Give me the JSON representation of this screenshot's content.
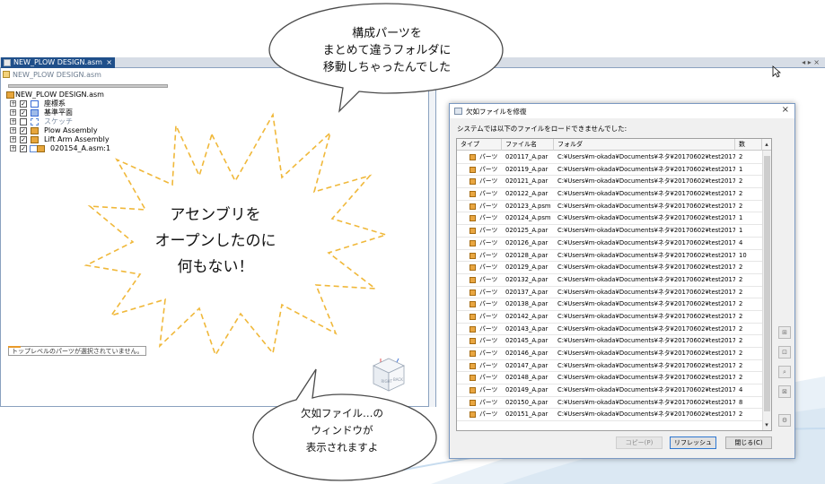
{
  "cad": {
    "tab_label": "NEW_PLOW DESIGN.asm",
    "tab_close": "×",
    "tab_nav": "◂ ▸ ×",
    "pane_title": "NEW_PLOW DESIGN.asm",
    "tree": {
      "root_label": "NEW_PLOW DESIGN.asm",
      "items": [
        {
          "label": "座標系",
          "icon": "coordinate-system-icon",
          "checked": true
        },
        {
          "label": "基準平面",
          "icon": "reference-plane-icon",
          "checked": true
        },
        {
          "label": "スケッチ",
          "icon": "sketch-icon",
          "checked": false
        },
        {
          "label": "Plow Assembly",
          "icon": "assembly-icon",
          "checked": true
        },
        {
          "label": "Lift Arm Assembly",
          "icon": "assembly-icon",
          "checked": true
        },
        {
          "label": "020154_A.asm:1",
          "icon": "assembly-icon",
          "checked": true
        }
      ]
    },
    "status_message": "トップレベルのパーツが選択されていません。",
    "view_cube": {
      "right": "RIGHT",
      "back": "BACK"
    }
  },
  "dialog": {
    "title": "欠如ファイルを修復",
    "close": "×",
    "message": "システムでは以下のファイルをロードできませんでした:",
    "columns": {
      "type": "タイプ",
      "name": "ファイル名",
      "folder": "フォルダ",
      "count": "数"
    },
    "rows": [
      {
        "type": "パーツ",
        "name": "020117_A.par",
        "folder": "C:¥Users¥m-okada¥Documents¥ネタ¥20170602¥test20170602",
        "count": "2"
      },
      {
        "type": "パーツ",
        "name": "020119_A.par",
        "folder": "C:¥Users¥m-okada¥Documents¥ネタ¥20170602¥test20170602",
        "count": "1"
      },
      {
        "type": "パーツ",
        "name": "020121_A.par",
        "folder": "C:¥Users¥m-okada¥Documents¥ネタ¥20170602¥test20170602",
        "count": "2"
      },
      {
        "type": "パーツ",
        "name": "020122_A.par",
        "folder": "C:¥Users¥m-okada¥Documents¥ネタ¥20170602¥test20170602",
        "count": "2"
      },
      {
        "type": "パーツ",
        "name": "020123_A.psm",
        "folder": "C:¥Users¥m-okada¥Documents¥ネタ¥20170602¥test20170602",
        "count": "2"
      },
      {
        "type": "パーツ",
        "name": "020124_A.psm",
        "folder": "C:¥Users¥m-okada¥Documents¥ネタ¥20170602¥test20170602",
        "count": "1"
      },
      {
        "type": "パーツ",
        "name": "020125_A.par",
        "folder": "C:¥Users¥m-okada¥Documents¥ネタ¥20170602¥test20170602",
        "count": "1"
      },
      {
        "type": "パーツ",
        "name": "020126_A.par",
        "folder": "C:¥Users¥m-okada¥Documents¥ネタ¥20170602¥test20170602",
        "count": "4"
      },
      {
        "type": "パーツ",
        "name": "020128_A.par",
        "folder": "C:¥Users¥m-okada¥Documents¥ネタ¥20170602¥test20170602",
        "count": "10"
      },
      {
        "type": "パーツ",
        "name": "020129_A.par",
        "folder": "C:¥Users¥m-okada¥Documents¥ネタ¥20170602¥test20170602",
        "count": "2"
      },
      {
        "type": "パーツ",
        "name": "020132_A.par",
        "folder": "C:¥Users¥m-okada¥Documents¥ネタ¥20170602¥test20170602",
        "count": "2"
      },
      {
        "type": "パーツ",
        "name": "020137_A.par",
        "folder": "C:¥Users¥m-okada¥Documents¥ネタ¥20170602¥test20170602",
        "count": "2"
      },
      {
        "type": "パーツ",
        "name": "020138_A.par",
        "folder": "C:¥Users¥m-okada¥Documents¥ネタ¥20170602¥test20170602",
        "count": "2"
      },
      {
        "type": "パーツ",
        "name": "020142_A.par",
        "folder": "C:¥Users¥m-okada¥Documents¥ネタ¥20170602¥test20170602",
        "count": "2"
      },
      {
        "type": "パーツ",
        "name": "020143_A.par",
        "folder": "C:¥Users¥m-okada¥Documents¥ネタ¥20170602¥test20170602",
        "count": "2"
      },
      {
        "type": "パーツ",
        "name": "020145_A.par",
        "folder": "C:¥Users¥m-okada¥Documents¥ネタ¥20170602¥test20170602",
        "count": "2"
      },
      {
        "type": "パーツ",
        "name": "020146_A.par",
        "folder": "C:¥Users¥m-okada¥Documents¥ネタ¥20170602¥test20170602",
        "count": "2"
      },
      {
        "type": "パーツ",
        "name": "020147_A.par",
        "folder": "C:¥Users¥m-okada¥Documents¥ネタ¥20170602¥test20170602",
        "count": "2"
      },
      {
        "type": "パーツ",
        "name": "020148_A.par",
        "folder": "C:¥Users¥m-okada¥Documents¥ネタ¥20170602¥test20170602",
        "count": "2"
      },
      {
        "type": "パーツ",
        "name": "020149_A.par",
        "folder": "C:¥Users¥m-okada¥Documents¥ネタ¥20170602¥test20170602",
        "count": "4"
      },
      {
        "type": "パーツ",
        "name": "020150_A.par",
        "folder": "C:¥Users¥m-okada¥Documents¥ネタ¥20170602¥test20170602",
        "count": "8"
      },
      {
        "type": "パーツ",
        "name": "020151_A.par",
        "folder": "C:¥Users¥m-okada¥Documents¥ネタ¥20170602¥test20170602",
        "count": "2"
      }
    ],
    "buttons": {
      "copy": "コピー(P)",
      "refresh": "リフレッシュ",
      "close": "閉じる(C)"
    }
  },
  "annotations": {
    "top_bubble": [
      "構成パーツを",
      "まとめて違うフォルダに",
      "移動しちゃったんでした"
    ],
    "burst": [
      "アセンブリを",
      "オープンしたのに",
      "何もない！"
    ],
    "bottom_bubble": [
      "欠如ファイル…の",
      "ウィンドウが",
      "表示されますよ"
    ]
  },
  "colors": {
    "tab_active": "#1f4f8a",
    "part_icon": "#e9a641",
    "annotation_dash": "#f0b83a",
    "accent_border": "#2f78d1"
  }
}
